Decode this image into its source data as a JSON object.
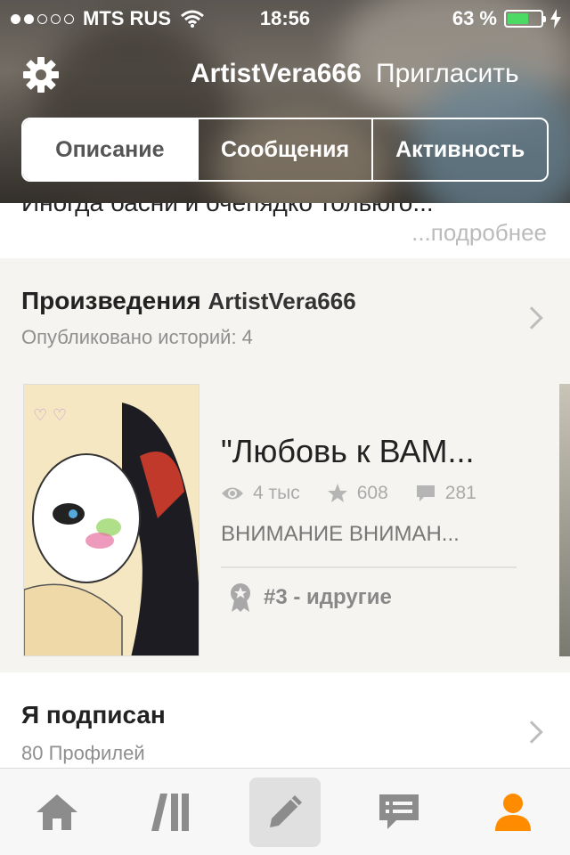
{
  "status_bar": {
    "carrier": "MTS RUS",
    "time": "18:56",
    "battery_percent": "63 %",
    "signal_bars_filled": 2,
    "signal_bars_total": 5
  },
  "header": {
    "username": "ArtistVera666",
    "invite_label": "Пригласить",
    "settings_icon": "gear-icon"
  },
  "segments": [
    {
      "label": "Описание",
      "selected": true
    },
    {
      "label": "Сообщения",
      "selected": false
    },
    {
      "label": "Активность",
      "selected": false
    }
  ],
  "about": {
    "cut_text": "Иногда басни и очепядко тольюго...",
    "more_label": "...подробнее"
  },
  "works": {
    "title": "Произведения",
    "owner": "ArtistVera666",
    "subtitle": "Опубликовано историй: 4",
    "story": {
      "title": "\"Любовь к ВАМ...",
      "reads": "4 тыс",
      "votes": "608",
      "comments": "281",
      "description": "ВНИМАНИЕ ВНИМАН...",
      "rank": "#3 - идругие"
    }
  },
  "following": {
    "title": "Я подписан",
    "subtitle": "80 Профилей"
  },
  "tabbar": {
    "items": [
      "home-icon",
      "library-icon",
      "write-icon",
      "messages-icon",
      "profile-icon"
    ],
    "active_color": "#ff8c00"
  },
  "colors": {
    "accent": "#ff8c00",
    "battery": "#4cd964"
  }
}
